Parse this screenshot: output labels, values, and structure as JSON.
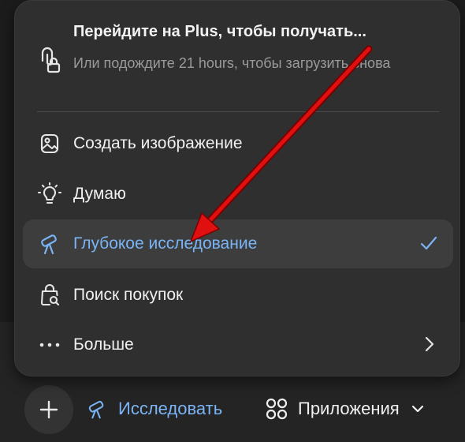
{
  "menu": {
    "upsell": {
      "title": "Перейдите на Plus, чтобы получать...",
      "subtitle": "Или подождите 21 hours, чтобы загрузить снова",
      "icon": "paperclip-lock-icon"
    },
    "items": [
      {
        "label": "Создать изображение",
        "icon": "image-icon"
      },
      {
        "label": "Думаю",
        "icon": "lightbulb-icon"
      },
      {
        "label": "Глубокое исследование",
        "icon": "telescope-icon",
        "selected": true,
        "trailing": "checkmark-icon"
      },
      {
        "label": "Поиск покупок",
        "icon": "shopping-bag-search-icon"
      },
      {
        "label": "Больше",
        "icon": "more-dots-icon",
        "trailing": "chevron-right-icon"
      }
    ]
  },
  "composer": {
    "plus_icon": "plus-icon",
    "research_label": "Исследовать",
    "apps_label": "Приложения"
  },
  "colors": {
    "menu_bg": "#2f2f2f",
    "selected_bg": "#3d3d3d",
    "accent_blue": "#7ab4f5",
    "annotation_arrow": "#e01010"
  }
}
